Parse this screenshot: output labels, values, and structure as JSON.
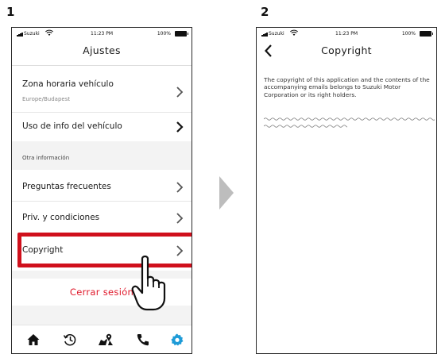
{
  "steps": [
    "1",
    "2"
  ],
  "status_bar": {
    "carrier": "Suzuki",
    "time": "11:23 PM",
    "battery": "100%"
  },
  "screen1": {
    "title": "Ajustes",
    "rows": {
      "timezone": {
        "label": "Zona horaria vehículo",
        "value": "Europe/Budapest"
      },
      "vehicle_info": {
        "label": "Uso de info del vehículo"
      },
      "section_label": "Otra información",
      "faq": {
        "label": "Preguntas frecuentes"
      },
      "privacy": {
        "label": "Priv. y condiciones"
      },
      "copyright": {
        "label": "Copyright"
      }
    },
    "logout_label": "Cerrar sesión",
    "tabs": [
      "home-icon",
      "history-icon",
      "map-icon",
      "phone-icon",
      "settings-icon"
    ],
    "colors": {
      "accent": "#1e9bd7",
      "logout": "#e0192b",
      "highlight": "#d0101c"
    }
  },
  "screen2": {
    "title": "Copyright",
    "text": "The copyright of this application and the contents of the accompanying emails belongs to Suzuki Motor Corporation or its right holders."
  }
}
